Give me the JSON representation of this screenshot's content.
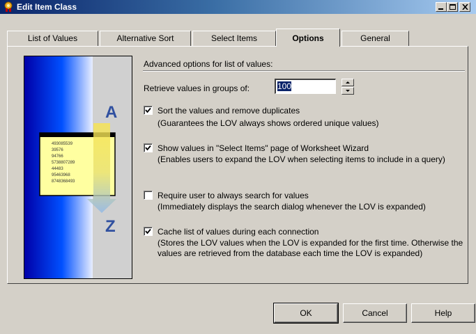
{
  "window": {
    "title": "Edit Item Class"
  },
  "tabs": [
    {
      "label": "List of Values"
    },
    {
      "label": "Alternative Sort"
    },
    {
      "label": "Select Items"
    },
    {
      "label": "Options"
    },
    {
      "label": "General"
    }
  ],
  "active_tab": "Options",
  "illustration": {
    "top_letter": "A",
    "bottom_letter": "Z",
    "numbers": [
      "493085539",
      "39576",
      "94766",
      "5738807289",
      "44483",
      "95463968",
      "8748368493"
    ]
  },
  "options": {
    "section_title": "Advanced options for list of values:",
    "retrieve_label": "Retrieve values in groups of:",
    "retrieve_value": "100",
    "items": [
      {
        "label": "Sort the values and remove duplicates",
        "description": "(Guarantees the LOV always shows ordered unique values)",
        "checked": true
      },
      {
        "label": "Show values in \"Select Items\" page of Worksheet Wizard",
        "description": "(Enables users to expand the LOV when selecting items to include in a query)",
        "checked": true
      },
      {
        "label": "Require user to always search for values",
        "description": "(Immediately displays the search dialog whenever the LOV is expanded)",
        "checked": false
      },
      {
        "label": "Cache list of values during each connection",
        "description": "(Stores the LOV values when the LOV is expanded for the first time. Otherwise the values are retrieved from the database each time the LOV is expanded)",
        "checked": true
      }
    ]
  },
  "buttons": {
    "ok": "OK",
    "cancel": "Cancel",
    "help": "Help"
  }
}
